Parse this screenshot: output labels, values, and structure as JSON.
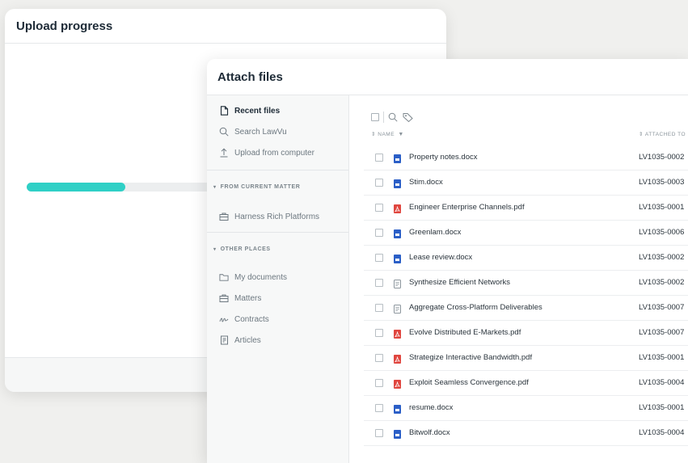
{
  "upload_progress": {
    "title": "Upload progress",
    "progress_fraction": 0.51
  },
  "attach_files": {
    "title": "Attach files",
    "sidebar": {
      "top_items": [
        {
          "label": "Recent files",
          "icon": "file-icon",
          "active": true
        },
        {
          "label": "Search LawVu",
          "icon": "search-icon",
          "active": false
        },
        {
          "label": "Upload from computer",
          "icon": "upload-icon",
          "active": false
        }
      ],
      "from_current_matter": {
        "title": "FROM CURRENT MATTER",
        "items": [
          {
            "label": "Harness Rich Platforms",
            "icon": "briefcase-icon"
          }
        ]
      },
      "other_places": {
        "title": "OTHER PLACES",
        "items": [
          {
            "label": "My documents",
            "icon": "folder-icon"
          },
          {
            "label": "Matters",
            "icon": "briefcase-icon"
          },
          {
            "label": "Contracts",
            "icon": "signature-icon"
          },
          {
            "label": "Articles",
            "icon": "article-icon"
          }
        ]
      }
    },
    "table": {
      "columns": {
        "name": "⇕ NAME",
        "attached_to": "⇕ ATTACHED TO"
      },
      "rows": [
        {
          "name": "Property notes.docx",
          "type": "docx",
          "attached": "LV1035-0002"
        },
        {
          "name": "Stim.docx",
          "type": "docx",
          "attached": "LV1035-0003"
        },
        {
          "name": "Engineer Enterprise Channels.pdf",
          "type": "pdf",
          "attached": "LV1035-0001"
        },
        {
          "name": "Greenlam.docx",
          "type": "docx",
          "attached": "LV1035-0006"
        },
        {
          "name": "Lease review.docx",
          "type": "docx",
          "attached": "LV1035-0002"
        },
        {
          "name": "Synthesize Efficient Networks",
          "type": "article",
          "attached": "LV1035-0002"
        },
        {
          "name": "Aggregate Cross-Platform Deliverables",
          "type": "article",
          "attached": "LV1035-0007"
        },
        {
          "name": "Evolve Distributed E-Markets.pdf",
          "type": "pdf",
          "attached": "LV1035-0007"
        },
        {
          "name": "Strategize Interactive Bandwidth.pdf",
          "type": "pdf",
          "attached": "LV1035-0001"
        },
        {
          "name": "Exploit Seamless Convergence.pdf",
          "type": "pdf",
          "attached": "LV1035-0004"
        },
        {
          "name": "resume.docx",
          "type": "docx",
          "attached": "LV1035-0001"
        },
        {
          "name": "Bitwolf.docx",
          "type": "docx",
          "attached": "LV1035-0004"
        }
      ]
    }
  },
  "colors": {
    "accent": "#2fd0c6",
    "docx": "#2b5fc7",
    "pdf": "#e0463f",
    "article": "#8c969d"
  }
}
